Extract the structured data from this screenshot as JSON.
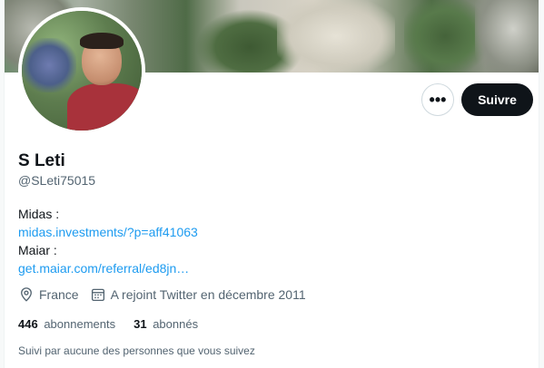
{
  "profile": {
    "name": "S Leti",
    "handle": "@SLeti75015",
    "bio": {
      "line1": "Midas :",
      "link1": "midas.investments/?p=aff41063",
      "line2": "Maiar :",
      "link2": "get.maiar.com/referral/ed8jn…"
    },
    "location": "France",
    "joined": "A rejoint Twitter en décembre 2011",
    "following_count": "446",
    "following_label": "abonnements",
    "followers_count": "31",
    "followers_label": "abonnés",
    "followed_by": "Suivi par aucune des personnes que vous suivez"
  },
  "actions": {
    "more_label": "•••",
    "follow_label": "Suivre"
  },
  "icons": {
    "more": "more-icon",
    "location": "location-pin-icon",
    "calendar": "calendar-icon"
  },
  "colors": {
    "link": "#1d9bf0",
    "follow_button_bg": "#0f1419",
    "secondary_text": "#536471"
  }
}
